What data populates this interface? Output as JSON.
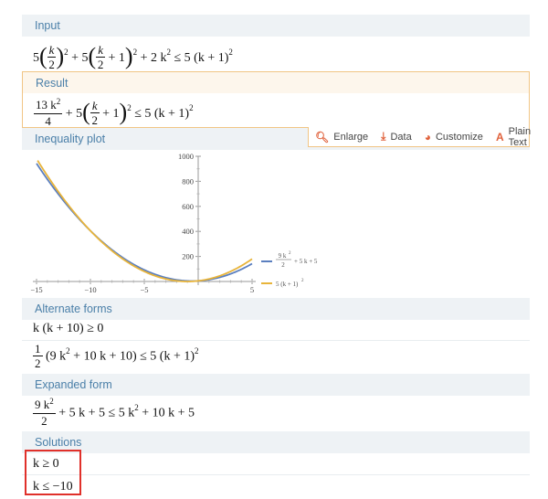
{
  "pods": {
    "input": {
      "title": "Input",
      "expr": {
        "c1": "5",
        "k": "k",
        "two": "2",
        "exp2": "2",
        "plus5": "+ 5",
        "one": "+ 1",
        "tail": "+ 2 k",
        "tail_exp": "2",
        "rel": "≤ 5 (k + 1)",
        "rel_exp": "2"
      }
    },
    "result": {
      "title": "Result",
      "expr": {
        "num": "13 k",
        "num_exp": "2",
        "den": "4",
        "plus5": "+ 5",
        "k": "k",
        "two": "2",
        "one": "+ 1",
        "exp2": "2",
        "rel": "≤ 5 (k + 1)",
        "rel_exp": "2"
      }
    },
    "plot": {
      "title": "Inequality plot",
      "toolbar": {
        "enlarge": "Enlarge",
        "data": "Data",
        "customize": "Customize",
        "plain_text": "Plain Text"
      }
    },
    "alternate": {
      "title": "Alternate forms",
      "form1": "k (k + 10) ≥ 0",
      "form2_coef_num": "1",
      "form2_coef_den": "2",
      "form2_body": "(9 k",
      "form2_exp": "2",
      "form2_rest": "+ 10 k + 10) ≤ 5 (k + 1)",
      "form2_rest_exp": "2"
    },
    "expanded": {
      "title": "Expanded form",
      "num": "9 k",
      "num_exp": "2",
      "den": "2",
      "rest": "+ 5 k + 5 ≤ 5 k",
      "rest_exp": "2",
      "rest2": "+ 10 k + 5"
    },
    "solutions": {
      "title": "Solutions",
      "sol1": "k ≥ 0",
      "sol2": "k ≤ −10"
    }
  },
  "colors": {
    "series1": "#5b7fbf",
    "series2": "#e8b43a",
    "pod_header_text": "#4a7fa8",
    "highlight_box": "#e0302a"
  },
  "chart_data": {
    "type": "line",
    "x_range": [
      -15,
      5
    ],
    "y_range": [
      0,
      1000
    ],
    "x_ticks": [
      "−15",
      "−10",
      "−5",
      "5"
    ],
    "y_ticks": [
      "1000",
      "800",
      "600",
      "400",
      "200"
    ],
    "series": [
      {
        "name": "9k²/2 + 5k + 5",
        "legend_num": "9 k",
        "legend_exp": "2",
        "legend_den": "2",
        "legend_rest": "+ 5 k + 5",
        "color": "#5b7fbf",
        "formula": "4.5k^2+5k+5"
      },
      {
        "name": "5(k+1)²",
        "legend_text": "5 (k + 1)",
        "legend_exp": "2",
        "color": "#e8b43a",
        "formula": "5(k+1)^2"
      }
    ]
  }
}
